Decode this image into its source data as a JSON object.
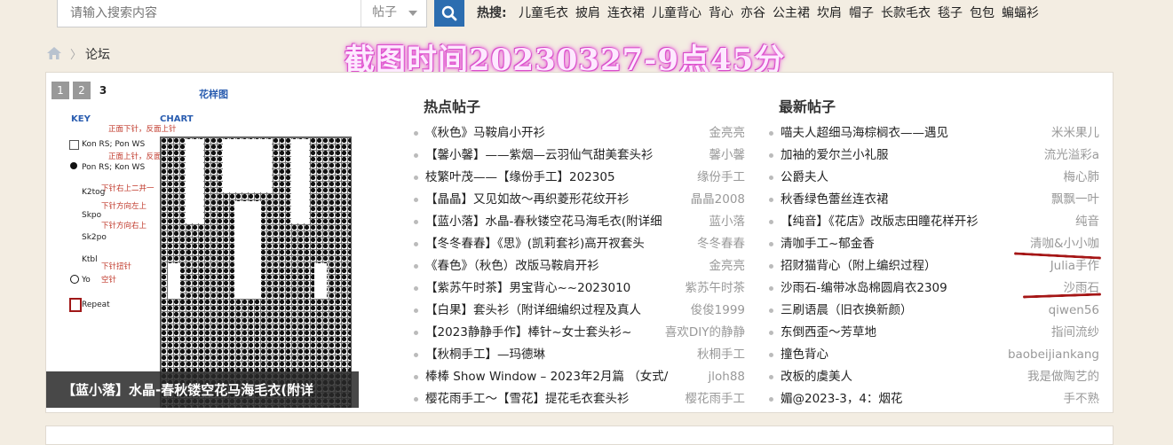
{
  "search": {
    "placeholder": "请输入搜索内容",
    "select": "帖子"
  },
  "hot_search": {
    "label": "热搜:",
    "links": [
      "儿童毛衣",
      "披肩",
      "连衣裙",
      "儿童背心",
      "背心",
      "亦谷",
      "公主裙",
      "坎肩",
      "帽子",
      "长款毛衣",
      "毯子",
      "包包",
      "蝙蝠衫"
    ]
  },
  "breadcrumb": {
    "sep": "〉",
    "current": "论坛"
  },
  "watermark": "截图时间20230327-9点45分",
  "slider": {
    "pages": [
      "1",
      "2",
      "3"
    ],
    "active_page": "3",
    "caption": "【蓝小落】水晶-春秋镂空花马海毛衣(附详",
    "chart_title": "花样图",
    "key_title": "KEY",
    "chart_label": "CHART",
    "key_items": [
      "Kon RS; Pon WS",
      "Pon RS; Kon WS",
      "K2tog",
      "Skpo",
      "Sk2po",
      "Ktbl",
      "Yo",
      "Repeat"
    ],
    "key_notes": [
      "正面下针，反面上针",
      "正面上针，反面下针",
      "下针右上二并一",
      "下针方向左上",
      "下针方向右上",
      "下针扭针",
      "空针"
    ]
  },
  "hot_posts": {
    "title": "热点帖子",
    "items": [
      {
        "title": "《秋色》马鞍肩小开衫",
        "author": "金亮亮"
      },
      {
        "title": "【馨小馨】——紫烟—云羽仙气甜美套头衫",
        "author": "馨小馨"
      },
      {
        "title": "枝繁叶茂——【缘份手工】202305",
        "author": "缘份手工"
      },
      {
        "title": "【晶晶】又见如故～再织菱形花纹开衫",
        "author": "晶晶2008"
      },
      {
        "title": "【蓝小落】水晶-春秋镂空花马海毛衣(附详细",
        "author": "蓝小落"
      },
      {
        "title": "【冬冬春春】《思》(凯莉套衫)高开衩套头",
        "author": "冬冬春春"
      },
      {
        "title": "《春色》（秋色）改版马鞍肩开衫",
        "author": "金亮亮"
      },
      {
        "title": "【紫苏午时茶】男宝背心~~2023010",
        "author": "紫苏午时茶"
      },
      {
        "title": "【白果】套头衫（附详细编织过程及真人",
        "author": "俊俊1999"
      },
      {
        "title": "【2023静静手作】棒针~女士套头衫~",
        "author": "喜欢DIY的静静"
      },
      {
        "title": "【秋桐手工】—玛德琳",
        "author": "秋桐手工"
      },
      {
        "title": "棒棒 Show Window – 2023年2月篇 （女式/",
        "author": "jloh88"
      },
      {
        "title": "樱花雨手工～【雪花】提花毛衣套头衫",
        "author": "樱花雨手工"
      }
    ]
  },
  "new_posts": {
    "title": "最新帖子",
    "items": [
      {
        "title": "喵夫人超细马海棕榈衣——遇见",
        "author": "米米果儿"
      },
      {
        "title": "加袖的爱尔兰小礼服",
        "author": "流光溢彩a"
      },
      {
        "title": "公爵夫人",
        "author": "梅心肺"
      },
      {
        "title": "秋香绿色蕾丝连衣裙",
        "author": "飘飘一叶"
      },
      {
        "title": "【纯音】《花店》改版志田瞳花样开衫",
        "author": "纯音"
      },
      {
        "title": "清咖手工~郁金香",
        "author": "清咖&小小咖"
      },
      {
        "title": "招财猫背心（附上编织过程）",
        "author": "Julia手作"
      },
      {
        "title": "沙雨石-编带冰岛棉圆肩衣2309",
        "author": "沙雨石"
      },
      {
        "title": "三刷语晨（旧衣换新颜）",
        "author": "qiwen56"
      },
      {
        "title": "东倒西歪～芳草地",
        "author": "指间流纱"
      },
      {
        "title": "撞色背心",
        "author": "baobeijiankang"
      },
      {
        "title": "改板的虞美人",
        "author": "我是做陶艺的"
      },
      {
        "title": "媚@2023-3，4：烟花",
        "author": "手不熟"
      }
    ]
  }
}
